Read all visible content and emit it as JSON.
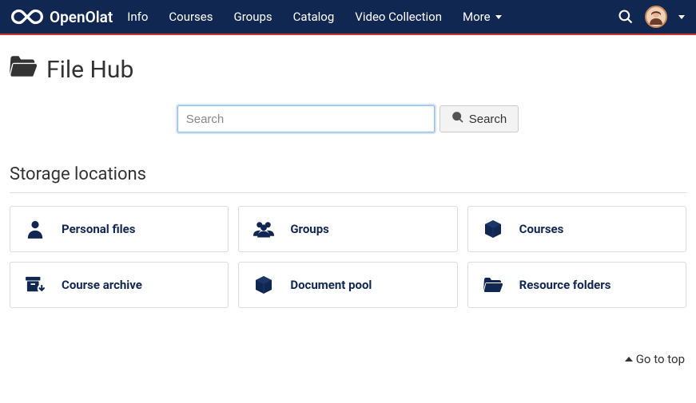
{
  "brand": {
    "name": "OpenOlat"
  },
  "nav": {
    "items": [
      "Info",
      "Courses",
      "Groups",
      "Catalog",
      "Video Collection"
    ],
    "more_label": "More"
  },
  "page": {
    "title": "File Hub",
    "search_placeholder": "Search",
    "search_button": "Search",
    "section_header": "Storage locations",
    "cards": [
      {
        "label": "Personal files",
        "icon": "user-icon"
      },
      {
        "label": "Groups",
        "icon": "users-icon"
      },
      {
        "label": "Courses",
        "icon": "cube-icon"
      },
      {
        "label": "Course archive",
        "icon": "archive-icon"
      },
      {
        "label": "Document pool",
        "icon": "box-icon"
      },
      {
        "label": "Resource folders",
        "icon": "folder-open-icon"
      }
    ],
    "go_top": "Go to top"
  }
}
